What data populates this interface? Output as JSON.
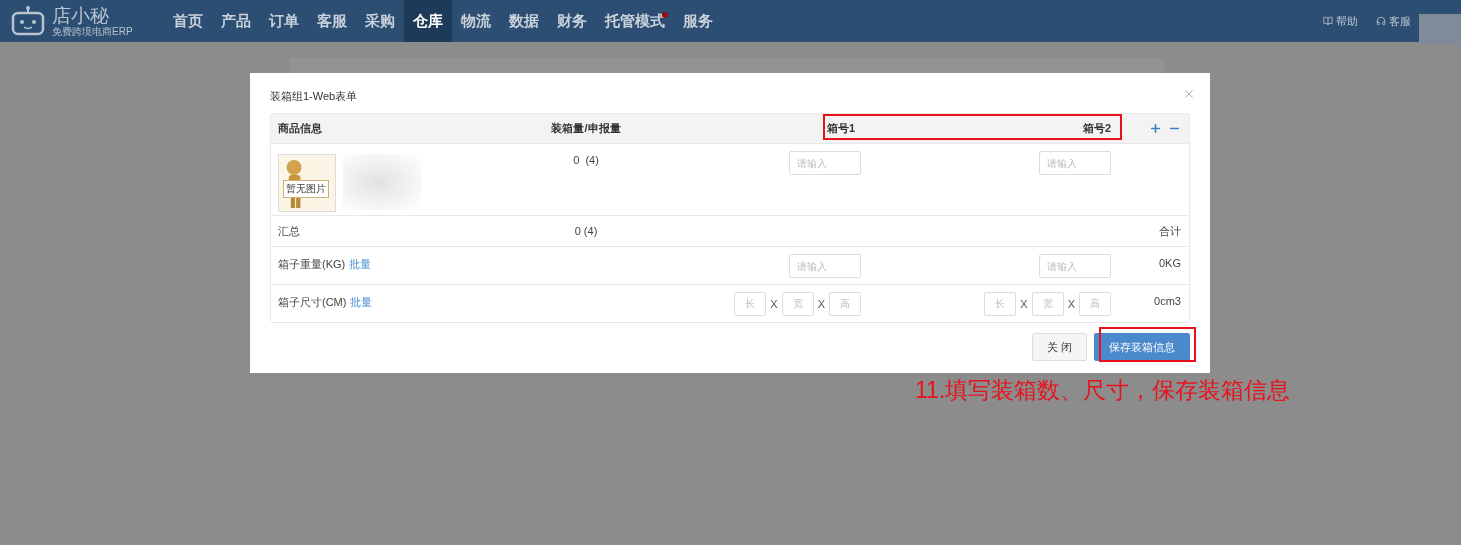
{
  "header": {
    "logo": {
      "name": "店小秘",
      "tagline": "免费跨境电商ERP"
    },
    "nav": [
      {
        "label": "首页",
        "selected": false,
        "badge": false
      },
      {
        "label": "产品",
        "selected": false,
        "badge": false
      },
      {
        "label": "订单",
        "selected": false,
        "badge": false
      },
      {
        "label": "客服",
        "selected": false,
        "badge": false
      },
      {
        "label": "采购",
        "selected": false,
        "badge": false
      },
      {
        "label": "仓库",
        "selected": true,
        "badge": false
      },
      {
        "label": "物流",
        "selected": false,
        "badge": false
      },
      {
        "label": "数据",
        "selected": false,
        "badge": false
      },
      {
        "label": "财务",
        "selected": false,
        "badge": false
      },
      {
        "label": "托管模式",
        "selected": false,
        "badge": true
      },
      {
        "label": "服务",
        "selected": false,
        "badge": false
      }
    ],
    "links": [
      {
        "kind": "book",
        "label": "帮助"
      },
      {
        "kind": "headset",
        "label": "客服"
      }
    ]
  },
  "modal": {
    "title": "装箱组1-Web表单",
    "columns": {
      "product": "商品信息",
      "quantity": "装箱量/申报量",
      "boxes": [
        "箱号1",
        "箱号2"
      ]
    },
    "product": {
      "image_label": "暂无图片",
      "quantity": "0  (4)",
      "box_inputs": [
        {
          "placeholder": "请输入"
        },
        {
          "placeholder": "请输入"
        }
      ]
    },
    "summary": {
      "label": "汇总",
      "quantity": "0 (4)",
      "total_label": "合计"
    },
    "weight": {
      "label": "箱子重量(KG)",
      "batch": "批量",
      "inputs": [
        {
          "placeholder": "请输入"
        },
        {
          "placeholder": "请输入"
        }
      ],
      "total": "0KG"
    },
    "size": {
      "label": "箱子尺寸(CM)",
      "batch": "批量",
      "boxes": [
        {
          "fields": [
            {
              "placeholder": "长"
            },
            {
              "sep": "X",
              "placeholder": "宽"
            },
            {
              "sep": "X",
              "placeholder": "高"
            }
          ]
        },
        {
          "fields": [
            {
              "placeholder": "长"
            },
            {
              "sep": "X",
              "placeholder": "宽"
            },
            {
              "sep": "X",
              "placeholder": "高"
            }
          ]
        }
      ],
      "total": "0cm3"
    },
    "buttons": [
      {
        "kind": "secondary",
        "label": "关 闭"
      },
      {
        "kind": "primary",
        "label": "保存装箱信息"
      }
    ]
  },
  "annotation": "11.填写装箱数、尺寸，保存装箱信息"
}
